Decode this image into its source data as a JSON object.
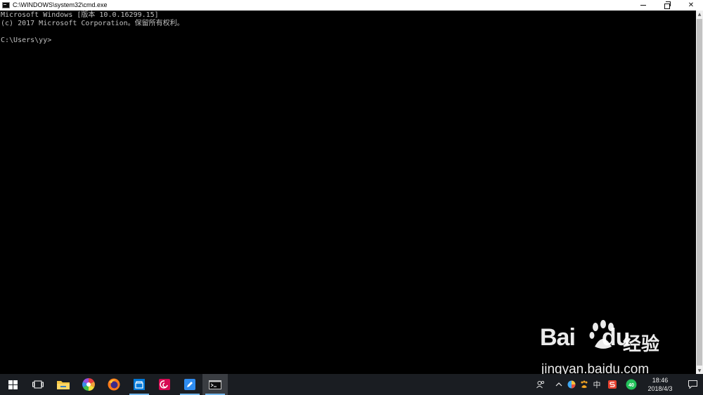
{
  "window": {
    "title": "C:\\WINDOWS\\system32\\cmd.exe",
    "minimize_label": "",
    "close_label": "✕"
  },
  "console": {
    "lines": [
      "Microsoft Windows [版本 10.0.16299.15]",
      "(c) 2017 Microsoft Corporation。保留所有权利。",
      "",
      "C:\\Users\\yy>"
    ]
  },
  "watermark": {
    "logo": "Bai",
    "logo_tail": "du",
    "cn": "经验",
    "url": "jingyan.baidu.com"
  },
  "taskbar": {
    "apps": [
      {
        "name": "start-button",
        "icon": "windows-logo-icon"
      },
      {
        "name": "task-view-button",
        "icon": "task-view-icon"
      },
      {
        "name": "file-explorer-button",
        "icon": "folder-icon"
      },
      {
        "name": "colorful-app-button",
        "icon": "color-wheel-icon"
      },
      {
        "name": "firefox-button",
        "icon": "firefox-icon"
      },
      {
        "name": "store-button",
        "icon": "store-icon"
      },
      {
        "name": "debian-app-button",
        "icon": "swirl-icon"
      },
      {
        "name": "note-app-button",
        "icon": "pen-icon"
      },
      {
        "name": "cmd-button",
        "icon": "terminal-icon"
      }
    ],
    "ime_label": "中",
    "badge_label": "40",
    "time": "18:46",
    "date": "2018/4/3"
  },
  "colors": {
    "console_text": "#c0c0c0",
    "taskbar_bg": "#1a1d22",
    "active_indicator": "#76b9ed"
  }
}
